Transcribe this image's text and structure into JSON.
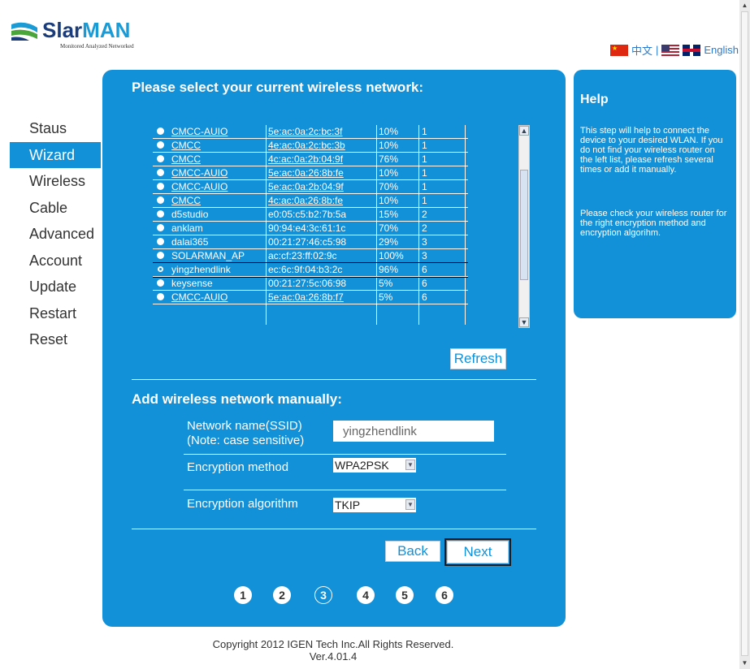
{
  "brand": {
    "name_part1": "S",
    "name_part2": "lar",
    "name_part3": "MAN",
    "tagline": "Monitored Analyzed Networked"
  },
  "language": {
    "chinese": "中文",
    "separator": "|",
    "english": "English"
  },
  "sidebar": {
    "items": [
      {
        "label": "Staus",
        "active": false
      },
      {
        "label": "Wizard",
        "active": true
      },
      {
        "label": "Wireless",
        "active": false
      },
      {
        "label": "Cable",
        "active": false
      },
      {
        "label": "Advanced",
        "active": false
      },
      {
        "label": "Account",
        "active": false
      },
      {
        "label": "Update",
        "active": false
      },
      {
        "label": "Restart",
        "active": false
      },
      {
        "label": "Reset",
        "active": false
      }
    ]
  },
  "main": {
    "select_title": "Please select your current wireless network:",
    "networks": [
      {
        "ssid": "CMCC-AUIO",
        "mac": "5e:ac:0a:2c:bc:3f",
        "signal": "10%",
        "channel": "1"
      },
      {
        "ssid": "CMCC",
        "mac": "4e:ac:0a:2c:bc:3b",
        "signal": "10%",
        "channel": "1"
      },
      {
        "ssid": "CMCC",
        "mac": "4c:ac:0a:2b:04:9f",
        "signal": "76%",
        "channel": "1"
      },
      {
        "ssid": "CMCC-AUIO",
        "mac": "5e:ac:0a:26:8b:fe",
        "signal": "10%",
        "channel": "1"
      },
      {
        "ssid": "CMCC-AUIO",
        "mac": "5e:ac:0a:2b:04:9f",
        "signal": "70%",
        "channel": "1"
      },
      {
        "ssid": "CMCC",
        "mac": "4c:ac:0a:26:8b:fe",
        "signal": "10%",
        "channel": "1"
      },
      {
        "ssid": "d5studio",
        "mac": "e0:05:c5:b2:7b:5a",
        "signal": "15%",
        "channel": "2"
      },
      {
        "ssid": "anklam",
        "mac": "90:94:e4:3c:61:1c",
        "signal": "70%",
        "channel": "2"
      },
      {
        "ssid": "dalai365",
        "mac": "00:21:27:46:c5:98",
        "signal": "29%",
        "channel": "3"
      },
      {
        "ssid": "SOLARMAN_AP",
        "mac": "ac:cf:23:ff:02:9c",
        "signal": "100%",
        "channel": "3"
      },
      {
        "ssid": "yingzhendlink",
        "mac": "ec:6c:9f:04:b3:2c",
        "signal": "96%",
        "channel": "6"
      },
      {
        "ssid": "keysense",
        "mac": "00:21:27:5c:06:98",
        "signal": "5%",
        "channel": "6"
      },
      {
        "ssid": "CMCC-AUIO",
        "mac": "5e:ac:0a:26:8b:f7",
        "signal": "5%",
        "channel": "6"
      }
    ],
    "refresh_label": "Refresh",
    "manual_title": "Add wireless network manually:",
    "ssid_label": "Network name(SSID)",
    "ssid_note": "(Note: case sensitive)",
    "ssid_value": "yingzhendlink",
    "enc_method_label": "Encryption method",
    "enc_method_value": "WPA2PSK",
    "enc_alg_label": "Encryption algorithm",
    "enc_alg_value": "TKIP",
    "back_label": "Back",
    "next_label": "Next",
    "steps": [
      "1",
      "2",
      "3",
      "4",
      "5",
      "6"
    ],
    "current_step": 3
  },
  "help": {
    "title": "Help",
    "para1": "This step will help to connect the device to your desired WLAN. If you do not find your wireless router on the left list, please refresh several times or add it manually.",
    "para2": "Please check your wireless router for the right encryption method and encryption algorihm."
  },
  "footer": {
    "copyright": "Copyright   2012 IGEN Tech Inc.All Rights Reserved.",
    "version": "Ver.4.01.4"
  },
  "colors": {
    "accent": "#1291d9",
    "brand_dark": "#1a3c7a",
    "link": "#2a7bd0"
  }
}
